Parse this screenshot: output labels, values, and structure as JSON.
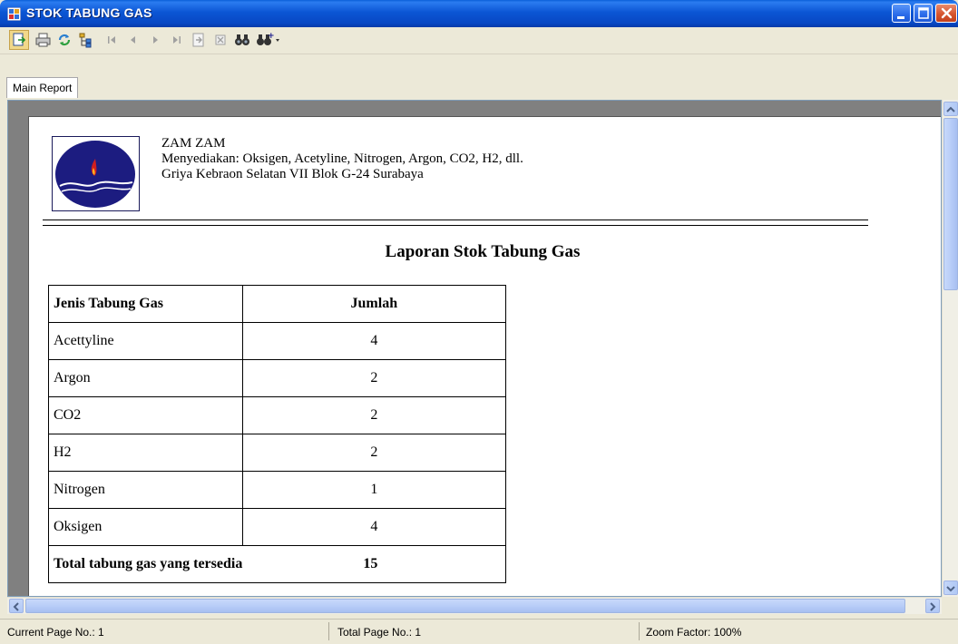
{
  "window": {
    "title": "STOK TABUNG GAS",
    "controls": [
      "minimize-icon",
      "maximize-icon",
      "close-icon"
    ]
  },
  "toolbar": {
    "buttons": [
      {
        "name": "export-button",
        "icon": "export-icon",
        "enabled": true
      },
      {
        "name": "print-button",
        "icon": "printer-icon",
        "enabled": true
      },
      {
        "name": "refresh-button",
        "icon": "refresh-icon",
        "enabled": true
      },
      {
        "name": "group-tree-button",
        "icon": "tree-icon",
        "enabled": true
      },
      {
        "name": "first-page-button",
        "icon": "first-page-icon",
        "enabled": false
      },
      {
        "name": "previous-page-button",
        "icon": "previous-page-icon",
        "enabled": false
      },
      {
        "name": "next-page-button",
        "icon": "next-page-icon",
        "enabled": false
      },
      {
        "name": "last-page-button",
        "icon": "last-page-icon",
        "enabled": false
      },
      {
        "name": "goto-page-button",
        "icon": "goto-page-icon",
        "enabled": false
      },
      {
        "name": "stop-button",
        "icon": "stop-icon",
        "enabled": false
      },
      {
        "name": "find-button",
        "icon": "binoculars-icon",
        "enabled": true
      },
      {
        "name": "zoom-button",
        "icon": "zoom-icon",
        "enabled": true
      }
    ]
  },
  "tabs": [
    {
      "label": "Main Report",
      "active": true
    }
  ],
  "report": {
    "company": {
      "name": "ZAM ZAM",
      "products": "Menyediakan: Oksigen, Acetyline, Nitrogen, Argon, CO2, H2, dll.",
      "address": "Griya Kebraon Selatan VII Blok G-24 Surabaya"
    },
    "title": "Laporan Stok Tabung Gas",
    "table": {
      "headers": [
        "Jenis Tabung Gas",
        "Jumlah"
      ],
      "rows": [
        [
          "Acettyline",
          "4"
        ],
        [
          "Argon",
          "2"
        ],
        [
          "CO2",
          "2"
        ],
        [
          "H2",
          "2"
        ],
        [
          "Nitrogen",
          "1"
        ],
        [
          "Oksigen",
          "4"
        ]
      ],
      "total_label": "Total tabung gas yang tersedia",
      "total_value": "15"
    }
  },
  "statusbar": {
    "current_page": "Current Page No.: 1",
    "total_page": "Total Page No.: 1",
    "zoom": "Zoom Factor: 100%"
  },
  "colors": {
    "titlebar": "#0b55d4",
    "chrome": "#ece9d8",
    "viewer_background": "#808080",
    "logo_ellipse": "#1c1c80",
    "logo_flame": "#d01f1f"
  }
}
